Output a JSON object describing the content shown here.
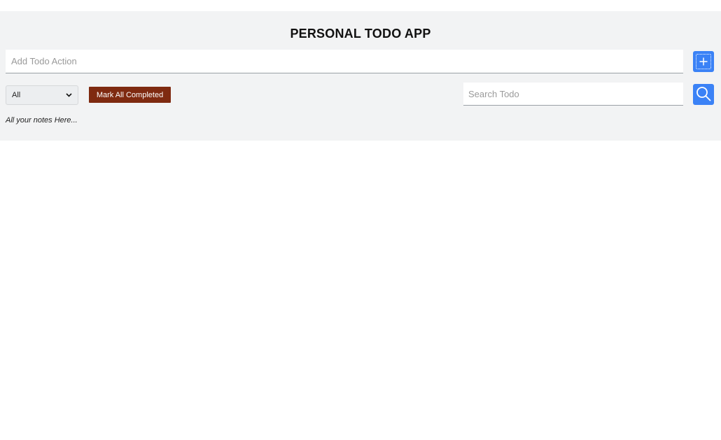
{
  "app": {
    "title": "PERSONAL TODO APP"
  },
  "add_todo": {
    "placeholder": "Add Todo Action",
    "value": "",
    "button_icon": "plus-icon"
  },
  "controls": {
    "filter_selected": "All",
    "filter_icon": "chevron-down-icon",
    "mark_all_label": "Mark All Completed"
  },
  "search": {
    "placeholder": "Search Todo",
    "value": "",
    "button_icon": "search-icon"
  },
  "notes": {
    "text": "All your notes Here..."
  },
  "colors": {
    "panel_background": "#f2f3f4",
    "accent_blue": "#3b82f6",
    "mark_button_brown": "#7f2a10",
    "page_background": "#ffffff"
  }
}
